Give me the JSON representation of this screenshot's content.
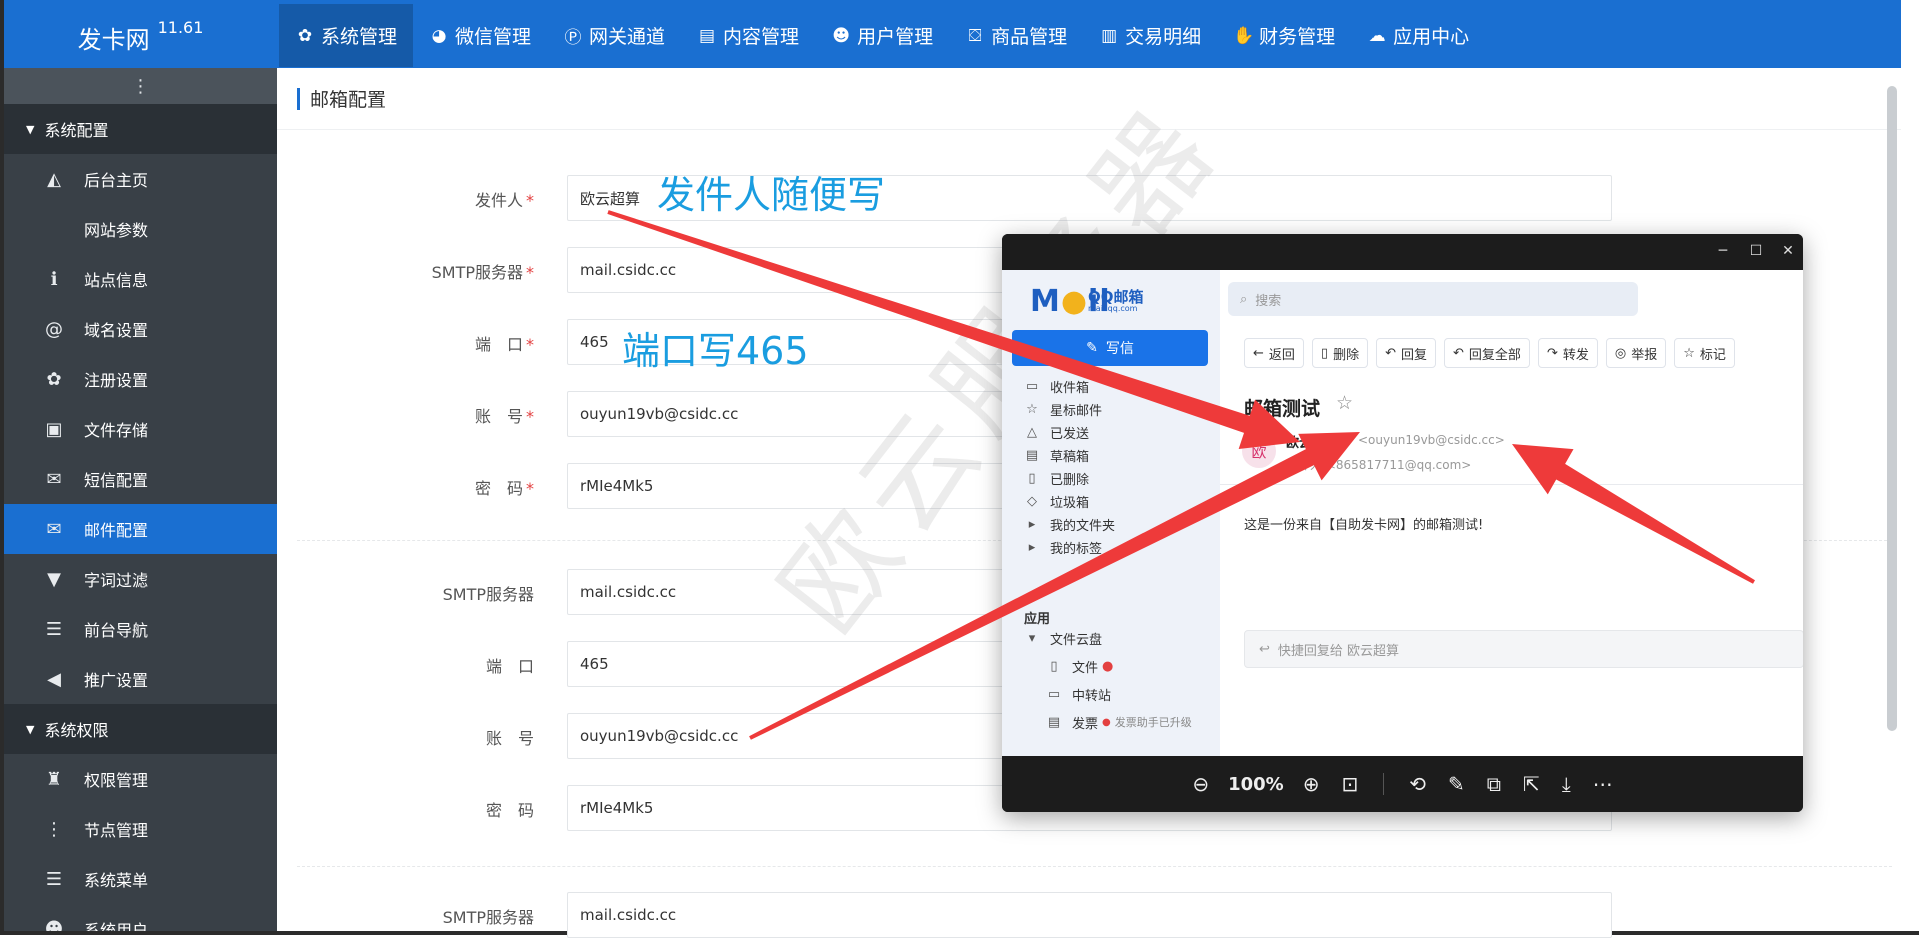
{
  "brand": {
    "name": "发卡网",
    "version": "11.61"
  },
  "top_nav": [
    {
      "icon": "gear-icon",
      "glyph": "✿",
      "label": "系统管理"
    },
    {
      "icon": "wechat-icon",
      "glyph": "◕",
      "label": "微信管理"
    },
    {
      "icon": "p-circle-icon",
      "glyph": "Ⓟ",
      "label": "网关通道"
    },
    {
      "icon": "document-icon",
      "glyph": "▤",
      "label": "内容管理"
    },
    {
      "icon": "users-icon",
      "glyph": "☻",
      "label": "用户管理"
    },
    {
      "icon": "shopping-bag-icon",
      "glyph": "⛋",
      "label": "商品管理"
    },
    {
      "icon": "bar-chart-icon",
      "glyph": "▥",
      "label": "交易明细"
    },
    {
      "icon": "finance-icon",
      "glyph": "✋",
      "label": "财务管理"
    },
    {
      "icon": "cloud-icon",
      "glyph": "☁",
      "label": "应用中心"
    }
  ],
  "sidebar": {
    "toggle": "⋮",
    "groups": [
      {
        "label": "系统配置",
        "items": [
          {
            "icon": "area-chart-icon",
            "glyph": "◭",
            "label": "后台主页"
          },
          {
            "icon": "apple-icon",
            "glyph": "",
            "label": "网站参数"
          },
          {
            "icon": "info-icon",
            "glyph": "ℹ",
            "label": "站点信息"
          },
          {
            "icon": "at-icon",
            "glyph": "@",
            "label": "域名设置"
          },
          {
            "icon": "cog-icon",
            "glyph": "✿",
            "label": "注册设置"
          },
          {
            "icon": "save-icon",
            "glyph": "▣",
            "label": "文件存储"
          },
          {
            "icon": "envelope-icon",
            "glyph": "✉",
            "label": "短信配置"
          },
          {
            "icon": "envelope-icon",
            "glyph": "✉",
            "label": "邮件配置",
            "active": true
          },
          {
            "icon": "filter-icon",
            "glyph": "▼",
            "label": "字词过滤"
          },
          {
            "icon": "bars-icon",
            "glyph": "☰",
            "label": "前台导航"
          },
          {
            "icon": "megaphone-icon",
            "glyph": "◀",
            "label": "推广设置"
          }
        ]
      },
      {
        "label": "系统权限",
        "items": [
          {
            "icon": "user-lock-icon",
            "glyph": "♜",
            "label": "权限管理"
          },
          {
            "icon": "vertical-dots-icon",
            "glyph": "⋮",
            "label": "节点管理"
          },
          {
            "icon": "bars-icon",
            "glyph": "☰",
            "label": "系统菜单"
          },
          {
            "icon": "users-icon",
            "glyph": "☻",
            "label": "系统用户"
          }
        ]
      }
    ]
  },
  "page": {
    "title": "邮箱配置"
  },
  "form": {
    "group1": {
      "sender": {
        "label": "发件人",
        "value": "欧云超算"
      },
      "smtp": {
        "label": "SMTP服务器",
        "value": "mail.csidc.cc"
      },
      "port": {
        "label": "端　口",
        "value": "465"
      },
      "account": {
        "label": "账　号",
        "value": "ouyun19vb@csidc.cc"
      },
      "password": {
        "label": "密　码",
        "value": "rMIe4Mk5"
      }
    },
    "group2": {
      "smtp": {
        "label": "SMTP服务器",
        "value": "mail.csidc.cc"
      },
      "port": {
        "label": "端　口",
        "value": "465"
      },
      "account": {
        "label": "账　号",
        "value": "ouyun19vb@csidc.cc"
      },
      "password": {
        "label": "密　码",
        "value": "rMIe4Mk5"
      }
    },
    "group3": {
      "smtp": {
        "label": "SMTP服务器",
        "value": "mail.csidc.cc"
      }
    },
    "required_mark": "*"
  },
  "annotations": {
    "sender_note": "发件人随便写",
    "port_note": "端口写465",
    "watermark": "欧云服务器",
    "arrow_color": "#ee3a3a"
  },
  "viewer": {
    "minimize": "─",
    "maximize": "☐",
    "close": "✕",
    "zoom": "100%",
    "toolbar": [
      "⊖",
      "⊕",
      "⊡",
      "⟲",
      "✎",
      "⧉",
      "⇱",
      "⤓",
      "⋯"
    ],
    "mail": {
      "logo": "M",
      "logo_o": "●",
      "logo_rest": "il",
      "logo_sub": "QQ邮箱",
      "logo_domain": "mail.qq.com",
      "search_placeholder": "搜索",
      "write": "写信",
      "folders": [
        "收件箱",
        "星标邮件",
        "已发送",
        "草稿箱",
        "已删除",
        "垃圾箱",
        "我的文件夹",
        "我的标签"
      ],
      "apps_title": "应用",
      "cloud": "文件云盘",
      "cloud_items": [
        "文件",
        "中转站",
        "发票"
      ],
      "invoice_note": "发票助手已升级",
      "tools": [
        "返回",
        "删除",
        "回复",
        "回复全部",
        "转发",
        "举报",
        "标记"
      ],
      "subject": "邮箱测试",
      "from_name": "欧云超算",
      "from_email": "<ouyun19vb@csidc.cc>",
      "to_label": "收件人",
      "to_email": "<865817711@qq.com>",
      "avatar": "欧",
      "body": "这是一份来自【自助发卡网】的邮箱测试!",
      "quick_reply": "快捷回复给 欧云超算"
    }
  }
}
